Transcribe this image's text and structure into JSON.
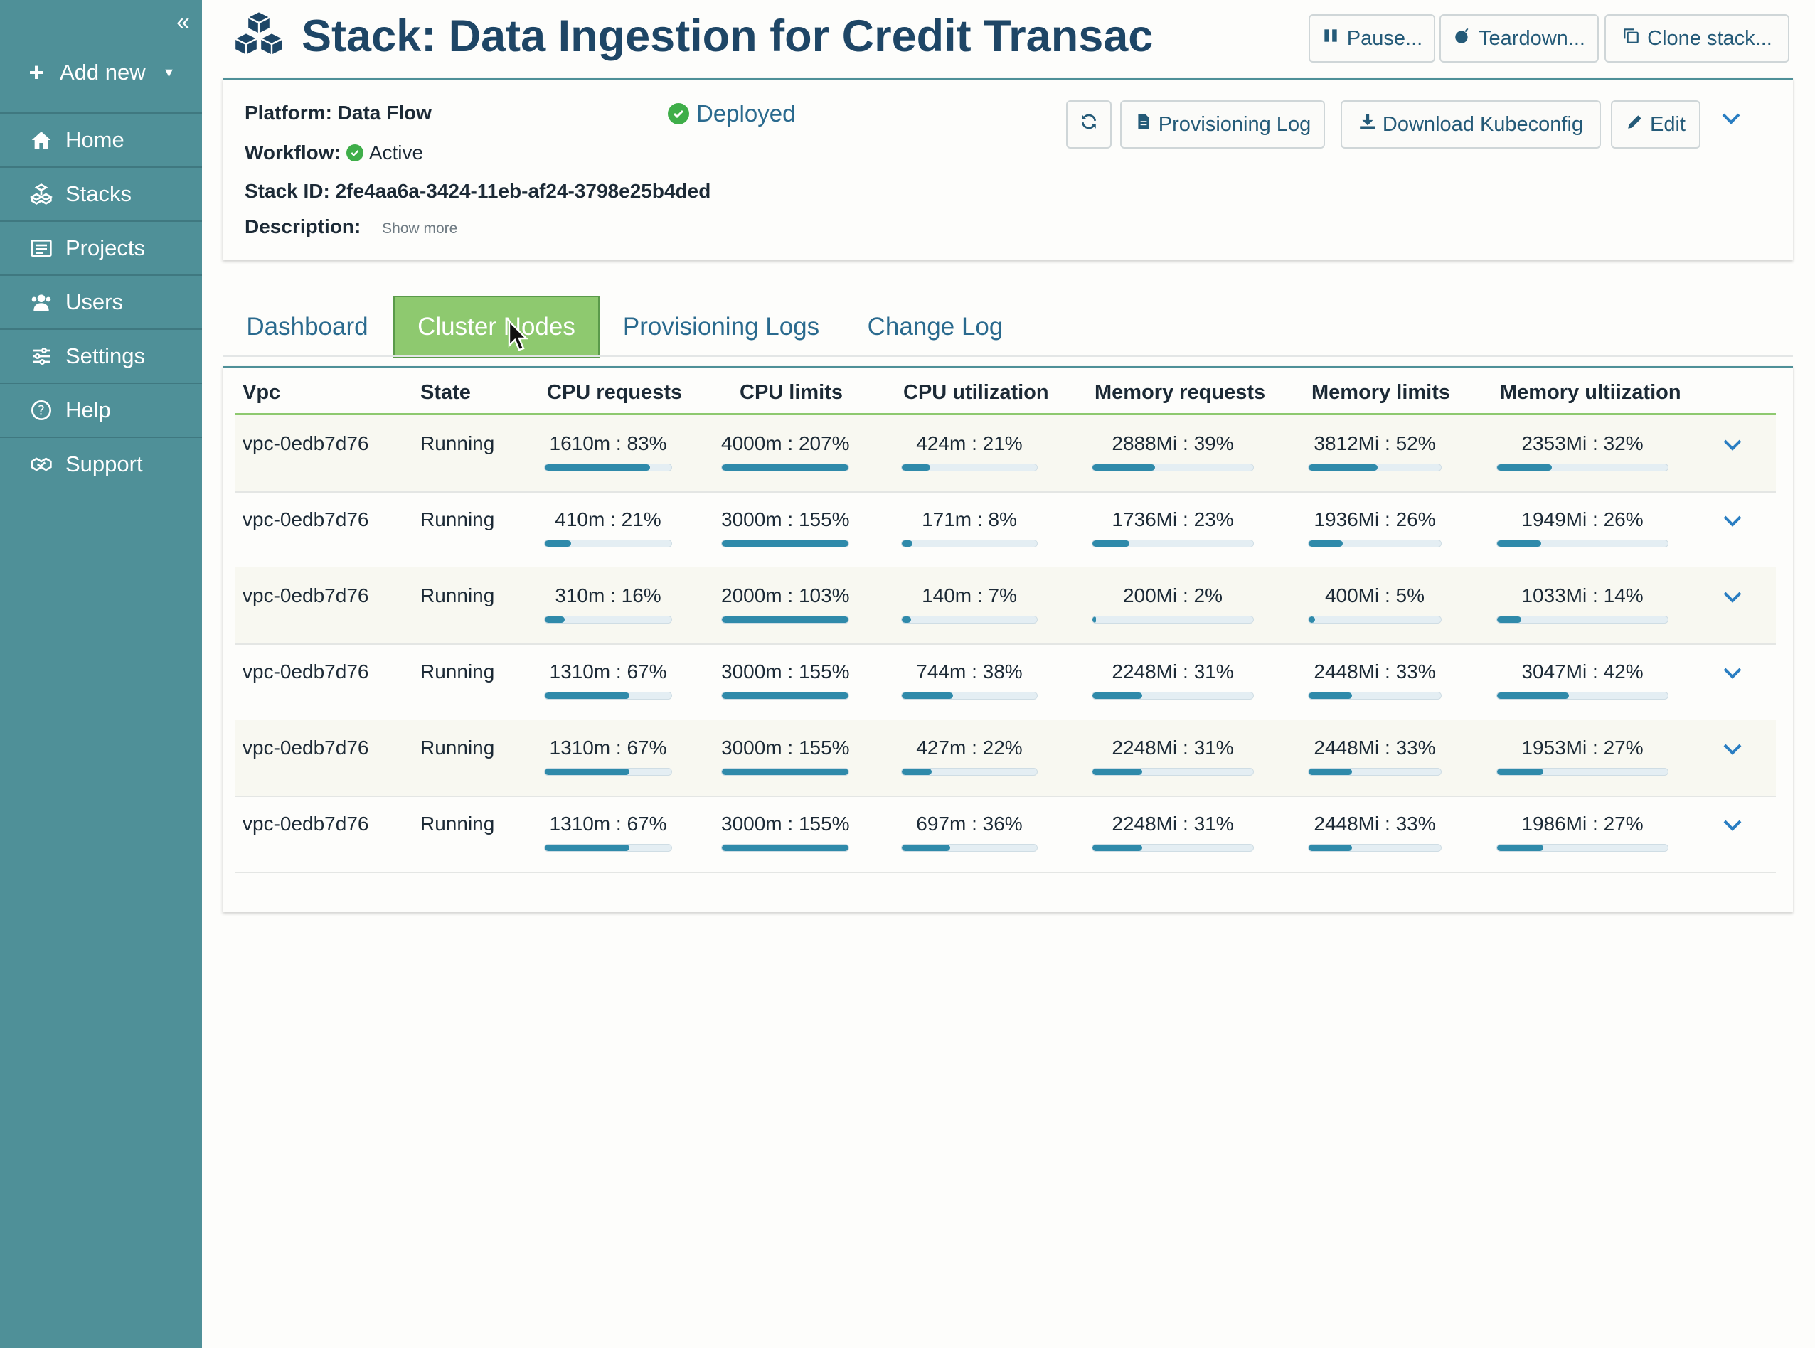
{
  "sidebar": {
    "collapse_glyph": "«",
    "add_new_label": "Add new",
    "items": [
      {
        "label": "Home",
        "icon": "home-icon"
      },
      {
        "label": "Stacks",
        "icon": "stacks-icon"
      },
      {
        "label": "Projects",
        "icon": "projects-icon"
      },
      {
        "label": "Users",
        "icon": "users-icon"
      },
      {
        "label": "Settings",
        "icon": "settings-icon"
      },
      {
        "label": "Help",
        "icon": "help-icon"
      },
      {
        "label": "Support",
        "icon": "support-icon"
      }
    ],
    "background_color": "#4f9098"
  },
  "header": {
    "title": "Stack: Data Ingestion for Credit Transac",
    "title_color": "#1e4666",
    "buttons": {
      "pause": "Pause...",
      "teardown": "Teardown...",
      "clone": "Clone stack..."
    }
  },
  "info": {
    "platform_label": "Platform:",
    "platform_value": "Data Flow",
    "status": "Deployed",
    "workflow_label": "Workflow:",
    "workflow_value": "Active",
    "stack_id_label": "Stack ID:",
    "stack_id_value": "2fe4aa6a-3424-11eb-af24-3798e25b4ded",
    "description_label": "Description:",
    "show_more": "Show more",
    "buttons": {
      "provisioning_log": "Provisioning Log",
      "download_kubeconfig": "Download Kubeconfig",
      "edit": "Edit"
    }
  },
  "tabs": [
    {
      "label": "Dashboard",
      "active": false
    },
    {
      "label": "Cluster Nodes",
      "active": true
    },
    {
      "label": "Provisioning Logs",
      "active": false
    },
    {
      "label": "Change Log",
      "active": false
    }
  ],
  "table": {
    "columns": [
      "Vpc",
      "State",
      "CPU requests",
      "CPU limits",
      "CPU utilization",
      "Memory requests",
      "Memory limits",
      "Memory ultiization"
    ],
    "rows": [
      {
        "vpc": "vpc-0edb7d76",
        "state": "Running",
        "cpu_requests": {
          "text": "1610m : 83%",
          "pct": 83
        },
        "cpu_limits": {
          "text": "4000m : 207%",
          "pct": 207
        },
        "cpu_util": {
          "text": "424m : 21%",
          "pct": 21
        },
        "mem_requests": {
          "text": "2888Mi : 39%",
          "pct": 39
        },
        "mem_limits": {
          "text": "3812Mi : 52%",
          "pct": 52
        },
        "mem_util": {
          "text": "2353Mi : 32%",
          "pct": 32
        }
      },
      {
        "vpc": "vpc-0edb7d76",
        "state": "Running",
        "cpu_requests": {
          "text": "410m : 21%",
          "pct": 21
        },
        "cpu_limits": {
          "text": "3000m : 155%",
          "pct": 155
        },
        "cpu_util": {
          "text": "171m : 8%",
          "pct": 8
        },
        "mem_requests": {
          "text": "1736Mi : 23%",
          "pct": 23
        },
        "mem_limits": {
          "text": "1936Mi : 26%",
          "pct": 26
        },
        "mem_util": {
          "text": "1949Mi : 26%",
          "pct": 26
        }
      },
      {
        "vpc": "vpc-0edb7d76",
        "state": "Running",
        "cpu_requests": {
          "text": "310m : 16%",
          "pct": 16
        },
        "cpu_limits": {
          "text": "2000m : 103%",
          "pct": 103
        },
        "cpu_util": {
          "text": "140m : 7%",
          "pct": 7
        },
        "mem_requests": {
          "text": "200Mi : 2%",
          "pct": 2
        },
        "mem_limits": {
          "text": "400Mi : 5%",
          "pct": 5
        },
        "mem_util": {
          "text": "1033Mi : 14%",
          "pct": 14
        }
      },
      {
        "vpc": "vpc-0edb7d76",
        "state": "Running",
        "cpu_requests": {
          "text": "1310m : 67%",
          "pct": 67
        },
        "cpu_limits": {
          "text": "3000m : 155%",
          "pct": 155
        },
        "cpu_util": {
          "text": "744m : 38%",
          "pct": 38
        },
        "mem_requests": {
          "text": "2248Mi : 31%",
          "pct": 31
        },
        "mem_limits": {
          "text": "2448Mi : 33%",
          "pct": 33
        },
        "mem_util": {
          "text": "3047Mi : 42%",
          "pct": 42
        }
      },
      {
        "vpc": "vpc-0edb7d76",
        "state": "Running",
        "cpu_requests": {
          "text": "1310m : 67%",
          "pct": 67
        },
        "cpu_limits": {
          "text": "3000m : 155%",
          "pct": 155
        },
        "cpu_util": {
          "text": "427m : 22%",
          "pct": 22
        },
        "mem_requests": {
          "text": "2248Mi : 31%",
          "pct": 31
        },
        "mem_limits": {
          "text": "2448Mi : 33%",
          "pct": 33
        },
        "mem_util": {
          "text": "1953Mi : 27%",
          "pct": 27
        }
      },
      {
        "vpc": "vpc-0edb7d76",
        "state": "Running",
        "cpu_requests": {
          "text": "1310m : 67%",
          "pct": 67
        },
        "cpu_limits": {
          "text": "3000m : 155%",
          "pct": 155
        },
        "cpu_util": {
          "text": "697m : 36%",
          "pct": 36
        },
        "mem_requests": {
          "text": "2248Mi : 31%",
          "pct": 31
        },
        "mem_limits": {
          "text": "2448Mi : 33%",
          "pct": 33
        },
        "mem_util": {
          "text": "1986Mi : 27%",
          "pct": 27
        }
      }
    ]
  },
  "colors": {
    "accent_teal": "#4f9098",
    "active_tab": "#8ec96f",
    "bar_fill": "#2f8aaa",
    "status_green": "#3fae49",
    "link_blue": "#2a6a8e"
  }
}
